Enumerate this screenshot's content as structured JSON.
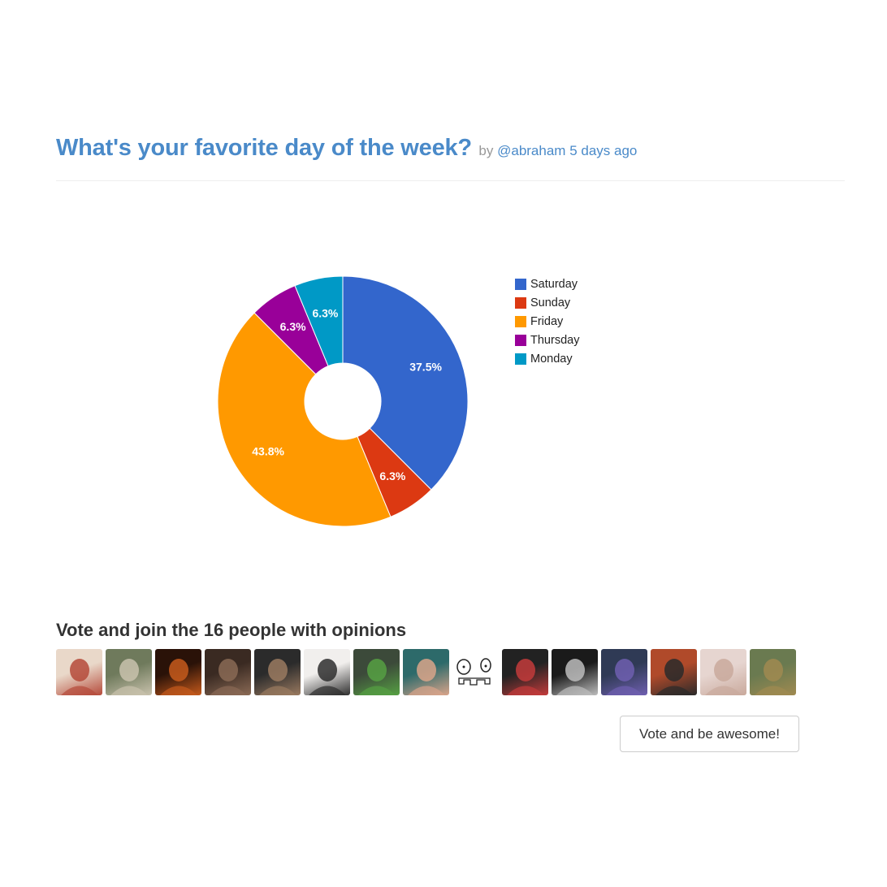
{
  "poll": {
    "title": "What's your favorite day of the week?",
    "by_prefix": "by",
    "author": "@abraham",
    "time_ago": "5 days ago"
  },
  "chart_data": {
    "type": "pie",
    "donut": true,
    "legend_position": "right",
    "slices": [
      {
        "label": "Saturday",
        "value": 37.5,
        "display": "37.5%",
        "color": "#3366cc"
      },
      {
        "label": "Sunday",
        "value": 6.25,
        "display": "6.3%",
        "color": "#dc3912"
      },
      {
        "label": "Friday",
        "value": 43.75,
        "display": "43.8%",
        "color": "#ff9900"
      },
      {
        "label": "Thursday",
        "value": 6.25,
        "display": "6.3%",
        "color": "#990099"
      },
      {
        "label": "Monday",
        "value": 6.25,
        "display": "6.3%",
        "color": "#0099c6"
      }
    ]
  },
  "voters": {
    "heading": "Vote and join the 16 people with opinions",
    "avatars": [
      {
        "name": "avatar-1",
        "colors": [
          "#e9d8c9",
          "#b54a3a"
        ]
      },
      {
        "name": "avatar-2",
        "colors": [
          "#6f7a5c",
          "#c9c2ad"
        ]
      },
      {
        "name": "avatar-3",
        "colors": [
          "#2a1208",
          "#c55a1c"
        ]
      },
      {
        "name": "avatar-4",
        "colors": [
          "#3a2a22",
          "#8a6a55"
        ]
      },
      {
        "name": "avatar-5",
        "colors": [
          "#2b2b2b",
          "#9a7a60"
        ]
      },
      {
        "name": "avatar-6",
        "colors": [
          "#f1efed",
          "#2e2e2e"
        ]
      },
      {
        "name": "avatar-7",
        "colors": [
          "#3c4a3a",
          "#56a043"
        ]
      },
      {
        "name": "avatar-8",
        "colors": [
          "#2d6a6a",
          "#d9a48a"
        ]
      },
      {
        "name": "avatar-9",
        "colors": [
          "#ffffff",
          "#222222"
        ]
      },
      {
        "name": "avatar-10",
        "colors": [
          "#222222",
          "#c33b3b"
        ]
      },
      {
        "name": "avatar-11",
        "colors": [
          "#1a1a1a",
          "#bdbdbd"
        ]
      },
      {
        "name": "avatar-12",
        "colors": [
          "#2f3a55",
          "#6f5fb0"
        ]
      },
      {
        "name": "avatar-13",
        "colors": [
          "#b04a2a",
          "#2a2a2a"
        ]
      },
      {
        "name": "avatar-14",
        "colors": [
          "#e6d5d0",
          "#c9a99c"
        ]
      },
      {
        "name": "avatar-15",
        "colors": [
          "#6a7a50",
          "#a08a50"
        ]
      }
    ]
  },
  "actions": {
    "vote_label": "Vote and be awesome!"
  }
}
